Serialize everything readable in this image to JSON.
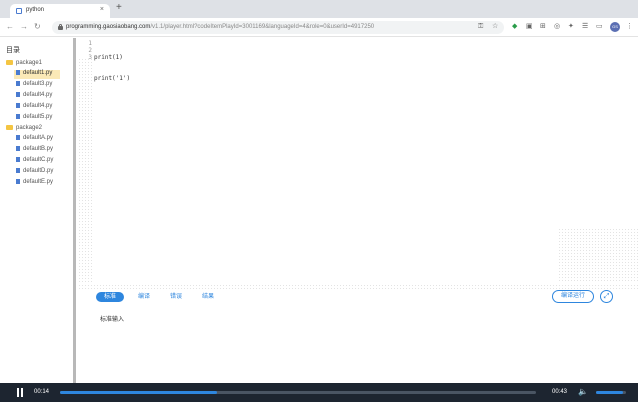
{
  "browser": {
    "tab_title": "python",
    "tab_close": "×",
    "new_tab": "+",
    "url_host": "programming.gaosiaobang.com",
    "url_path": "/v1.1/player.html?codeItemPlayId=3001169&languageId=4&role=0&userId=4917250",
    "nav_back": "←",
    "nav_forward": "→",
    "nav_reload": "↻",
    "profile_initials": "GS",
    "icons": [
      "key-icon",
      "star-icon",
      "extension-icon",
      "extension-icon",
      "extension-icon",
      "extension-icon",
      "puzzle-icon",
      "cast-icon",
      "menu-icon"
    ],
    "traffic_colors": [
      "#ff5f57",
      "#febc2e",
      "#28c840"
    ]
  },
  "sidebar": {
    "title": "目录",
    "folders": [
      {
        "name": "package1",
        "files": [
          "default1.py",
          "default3.py",
          "default4.py",
          "default4.py",
          "default5.py"
        ]
      },
      {
        "name": "package2",
        "files": [
          "defaultA.py",
          "defaultB.py",
          "defaultC.py",
          "defaultD.py",
          "defaultE.py"
        ]
      }
    ],
    "active_file": "default1.py"
  },
  "editor": {
    "line_numbers": [
      "1",
      "2",
      "3"
    ],
    "code_lines": [
      "print(1)",
      "print('1')",
      ""
    ]
  },
  "panel": {
    "tabs": [
      "标准",
      "编译",
      "错误",
      "结果"
    ],
    "active_tab_index": 0,
    "run_button": "编译运行",
    "expand_icon": "⤢",
    "stdin_label": "标准输入"
  },
  "player": {
    "current_time": "00:14",
    "total_time": "00:43",
    "progress": 0.33,
    "volume": 0.9,
    "volume_icon": "🔈",
    "accent_color": "#2e86de"
  }
}
